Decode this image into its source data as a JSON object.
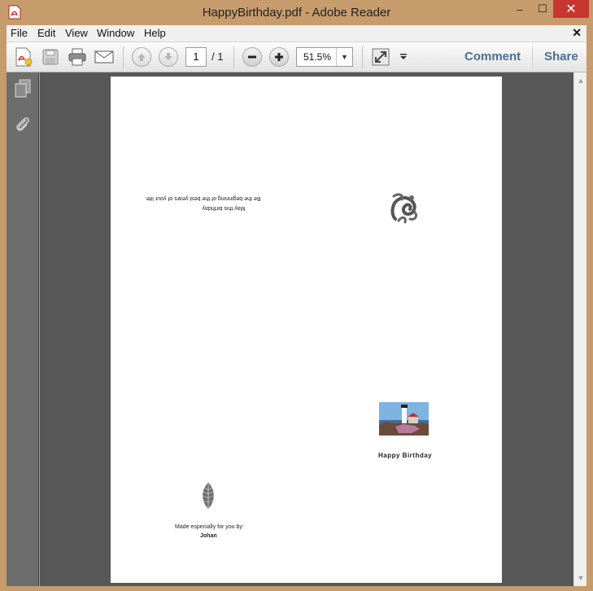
{
  "window": {
    "title": "HappyBirthday.pdf - Adobe Reader",
    "minimize": "–",
    "maximize": "☐",
    "close": "✕"
  },
  "menu": {
    "items": [
      "File",
      "Edit",
      "View",
      "Window",
      "Help"
    ],
    "close_doc": "✕"
  },
  "toolbar": {
    "page_current": "1",
    "page_total": "/ 1",
    "zoom": "51.5%",
    "comment_label": "Comment",
    "share_label": "Share"
  },
  "document": {
    "inverted_line1": "May this birthday",
    "inverted_line2": "Be the beginning of the best years of your life.",
    "card_title": "Happy Birthday",
    "made_by_label": "Made especially for you by:",
    "made_by_name": "Johan"
  }
}
